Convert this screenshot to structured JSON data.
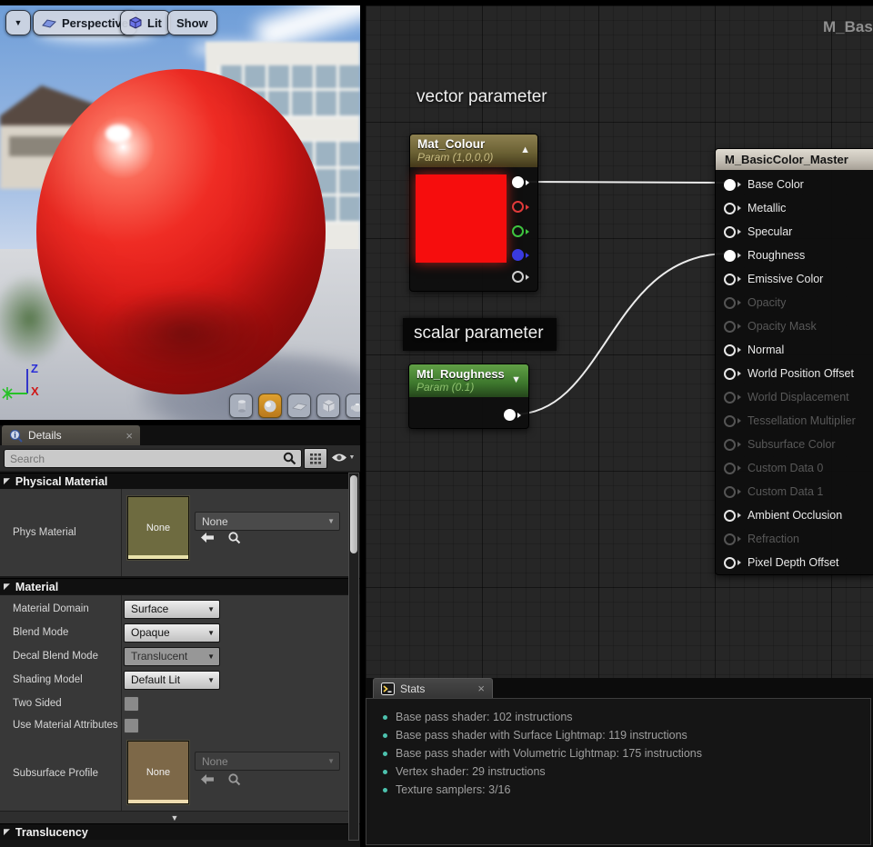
{
  "window": {
    "watermark": "M_Bas"
  },
  "icons": {
    "chevron_down": "▼",
    "section_expanded": "◤",
    "expander_more": "▼",
    "collapse_up": "▲",
    "collapse_down": "▼"
  },
  "viewport": {
    "toolbar": {
      "perspective_label": "Perspective",
      "lit_label": "Lit",
      "show_label": "Show"
    },
    "axis": {
      "z_label": "Z",
      "x_label": "X"
    },
    "shape_buttons": [
      {
        "name": "cylinder",
        "active": false
      },
      {
        "name": "sphere",
        "active": true
      },
      {
        "name": "plane",
        "active": false
      },
      {
        "name": "cube",
        "active": false
      },
      {
        "name": "teapot",
        "active": false
      }
    ]
  },
  "details": {
    "tab_label": "Details",
    "close_icon": "×",
    "search": {
      "placeholder": "Search"
    },
    "sections": {
      "physical_material": {
        "header": "Physical Material",
        "phys_material": {
          "label": "Phys Material",
          "thumbnail_text": "None",
          "dropdown_value": "None"
        }
      },
      "material": {
        "header": "Material",
        "rows": [
          {
            "label": "Material Domain",
            "value": "Surface",
            "disabled": false
          },
          {
            "label": "Blend Mode",
            "value": "Opaque",
            "disabled": false
          },
          {
            "label": "Decal Blend Mode",
            "value": "Translucent",
            "disabled": true
          },
          {
            "label": "Shading Model",
            "value": "Default Lit",
            "disabled": false
          }
        ],
        "two_sided_label": "Two Sided",
        "use_material_attributes_label": "Use Material Attributes",
        "subsurface_profile": {
          "label": "Subsurface Profile",
          "thumbnail_text": "None",
          "dropdown_value": "None"
        }
      },
      "translucency": {
        "header": "Translucency"
      }
    }
  },
  "graph": {
    "vector_label": "vector parameter",
    "scalar_label": "scalar parameter",
    "nodes": {
      "mat_colour": {
        "title": "Mat_Colour",
        "subtitle": "Param (1,0,0,0)",
        "swatch_color": "#f60d0d",
        "output_pins": [
          {
            "name": "rgba",
            "color": "#ffffff",
            "filled": true
          },
          {
            "name": "r",
            "color": "#e03a3a",
            "filled": false
          },
          {
            "name": "g",
            "color": "#3fc43f",
            "filled": false
          },
          {
            "name": "b",
            "color": "#3a3ae0",
            "filled": true
          },
          {
            "name": "a",
            "color": "#d0d0d0",
            "filled": false
          }
        ]
      },
      "mtl_roughness": {
        "title": "Mtl_Roughness",
        "subtitle": "Param (0.1)",
        "output_pins": [
          {
            "name": "value",
            "color": "#ffffff",
            "filled": true
          }
        ]
      },
      "master": {
        "title": "M_BasicColor_Master",
        "pins": [
          {
            "label": "Base Color",
            "state": "connected"
          },
          {
            "label": "Metallic",
            "state": "active"
          },
          {
            "label": "Specular",
            "state": "active"
          },
          {
            "label": "Roughness",
            "state": "connected"
          },
          {
            "label": "Emissive Color",
            "state": "active"
          },
          {
            "label": "Opacity",
            "state": "disabled"
          },
          {
            "label": "Opacity Mask",
            "state": "disabled"
          },
          {
            "label": "Normal",
            "state": "active"
          },
          {
            "label": "World Position Offset",
            "state": "active"
          },
          {
            "label": "World Displacement",
            "state": "disabled"
          },
          {
            "label": "Tessellation Multiplier",
            "state": "disabled"
          },
          {
            "label": "Subsurface Color",
            "state": "disabled"
          },
          {
            "label": "Custom Data 0",
            "state": "disabled"
          },
          {
            "label": "Custom Data 1",
            "state": "disabled"
          },
          {
            "label": "Ambient Occlusion",
            "state": "active"
          },
          {
            "label": "Refraction",
            "state": "disabled"
          },
          {
            "label": "Pixel Depth Offset",
            "state": "active"
          }
        ]
      }
    }
  },
  "stats": {
    "tab_label": "Stats",
    "close_icon": "×",
    "lines": [
      "Base pass shader: 102 instructions",
      "Base pass shader with Surface Lightmap: 119 instructions",
      "Base pass shader with Volumetric Lightmap: 175 instructions",
      "Vertex shader: 29 instructions",
      "Texture samplers: 3/16"
    ]
  },
  "colors": {
    "accent_orange": "#c98a24",
    "vector_node_header": "#6b6134",
    "scalar_node_header": "#3f7a2e",
    "stats_bullet": "#4cc2ae",
    "preview_red": "#e92722",
    "wire": "#ececec"
  }
}
